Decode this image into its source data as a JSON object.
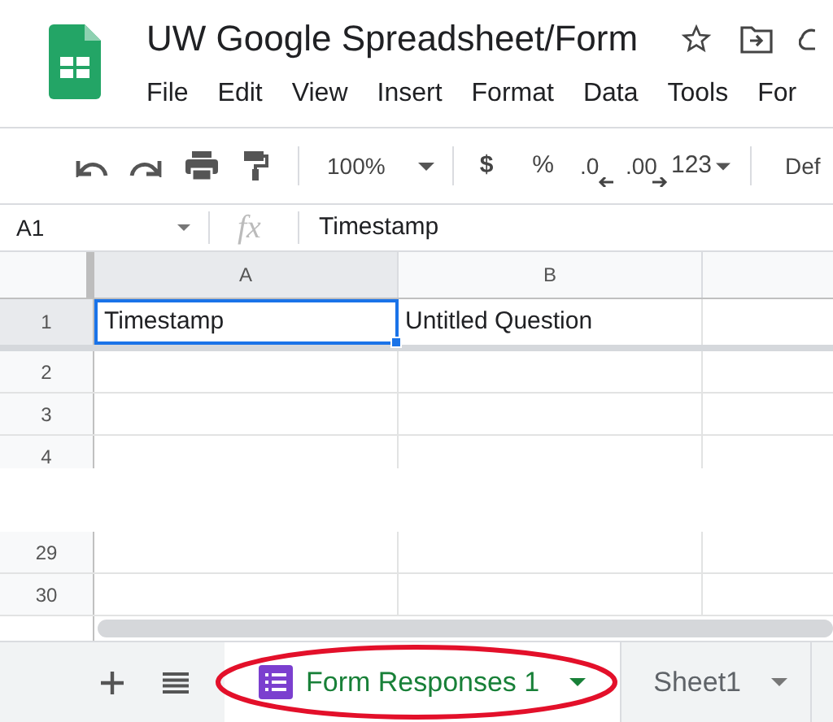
{
  "app": {
    "title": "UW Google Spreadsheet/Form",
    "menu": [
      "File",
      "Edit",
      "View",
      "Insert",
      "Format",
      "Data",
      "Tools",
      "For"
    ]
  },
  "toolbar": {
    "zoom": "100%",
    "currency": "$",
    "percent": "%",
    "decrease_decimals": ".0",
    "increase_decimals": ".00",
    "number_format": "123",
    "font": "Def"
  },
  "formula_bar": {
    "cell": "A1",
    "fx": "fx",
    "value": "Timestamp"
  },
  "grid": {
    "columns": [
      {
        "label": "A",
        "selected": true
      },
      {
        "label": "B",
        "selected": false
      }
    ],
    "rows": [
      {
        "label": "1",
        "selected": true,
        "cells": [
          {
            "text": "Timestamp",
            "selected": true
          },
          {
            "text": "Untitled Question",
            "selected": false
          }
        ]
      },
      {
        "label": "2",
        "selected": false
      },
      {
        "label": "3",
        "selected": false
      },
      {
        "label": "4",
        "selected": false
      }
    ],
    "rows_after_gap": [
      {
        "label": "29",
        "selected": false
      },
      {
        "label": "30",
        "selected": false
      }
    ]
  },
  "sheet_tabs": [
    {
      "label": "Form Responses 1",
      "selected": true,
      "kind": "form",
      "circled": true
    },
    {
      "label": "Sheet1",
      "selected": false,
      "kind": "plain",
      "circled": false
    }
  ]
}
